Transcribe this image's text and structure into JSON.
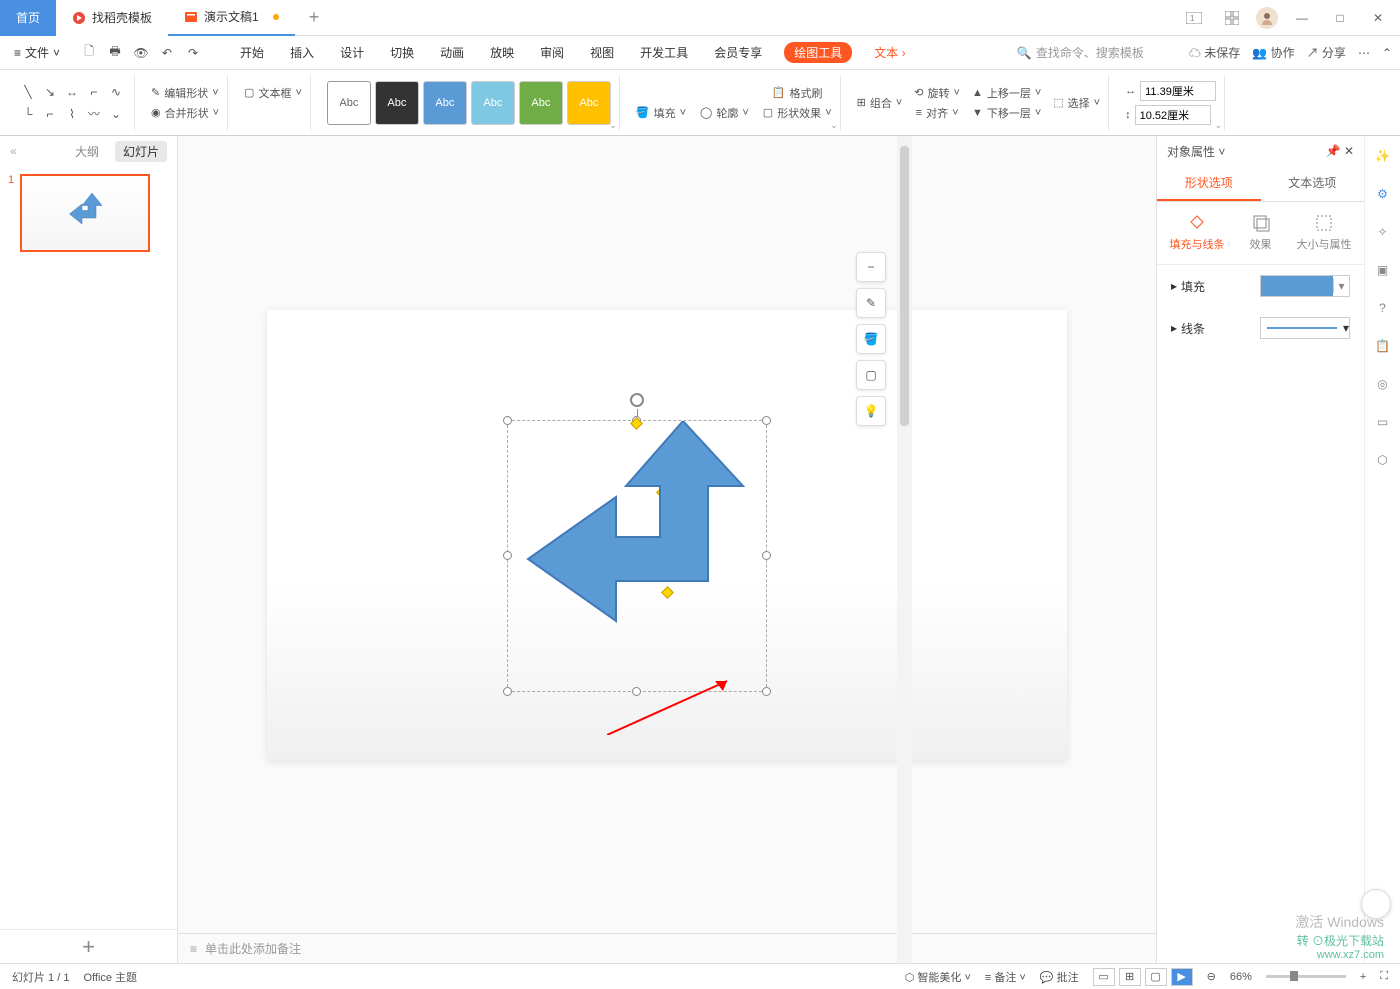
{
  "titlebar": {
    "home": "首页",
    "template": "找稻壳模板",
    "doc": "演示文稿1",
    "add": "+"
  },
  "menubar": {
    "file": "文件",
    "items": [
      "开始",
      "插入",
      "设计",
      "切换",
      "动画",
      "放映",
      "审阅",
      "视图",
      "开发工具",
      "会员专享"
    ],
    "toolTab": "绘图工具",
    "textTab": "文本",
    "searchPlaceholder": "查找命令、搜索模板",
    "unsaved": "未保存",
    "coop": "协作",
    "share": "分享"
  },
  "ribbon": {
    "editShape": "编辑形状",
    "mergeShape": "合并形状",
    "textBox": "文本框",
    "styleLabel": "Abc",
    "fill": "填充",
    "outline": "轮廓",
    "formatPainter": "格式刷",
    "shapeEffect": "形状效果",
    "group": "组合",
    "rotate": "旋转",
    "align": "对齐",
    "forward": "上移一层",
    "backward": "下移一层",
    "select": "选择",
    "width": "11.39厘米",
    "height": "10.52厘米"
  },
  "leftPanel": {
    "collapse": "«",
    "outline": "大纲",
    "slides": "幻灯片",
    "num1": "1",
    "add": "+"
  },
  "canvas": {
    "notesPlaceholder": "单击此处添加备注"
  },
  "floatTools": {
    "minus": "−"
  },
  "rightPanel": {
    "title": "对象属性",
    "shapeOpt": "形状选项",
    "textOpt": "文本选项",
    "fillLine": "填充与线条",
    "effect": "效果",
    "sizeProp": "大小与属性",
    "fill": "填充",
    "line": "线条"
  },
  "statusbar": {
    "slideCount": "幻灯片 1 / 1",
    "theme": "Office 主题",
    "smartBeautify": "智能美化",
    "notes": "备注",
    "comments": "批注",
    "zoom": "66%"
  },
  "watermark": {
    "l1": "激活 Windows",
    "l2": "转 ⊙极光下载站",
    "l3": "www.xz7.com"
  }
}
